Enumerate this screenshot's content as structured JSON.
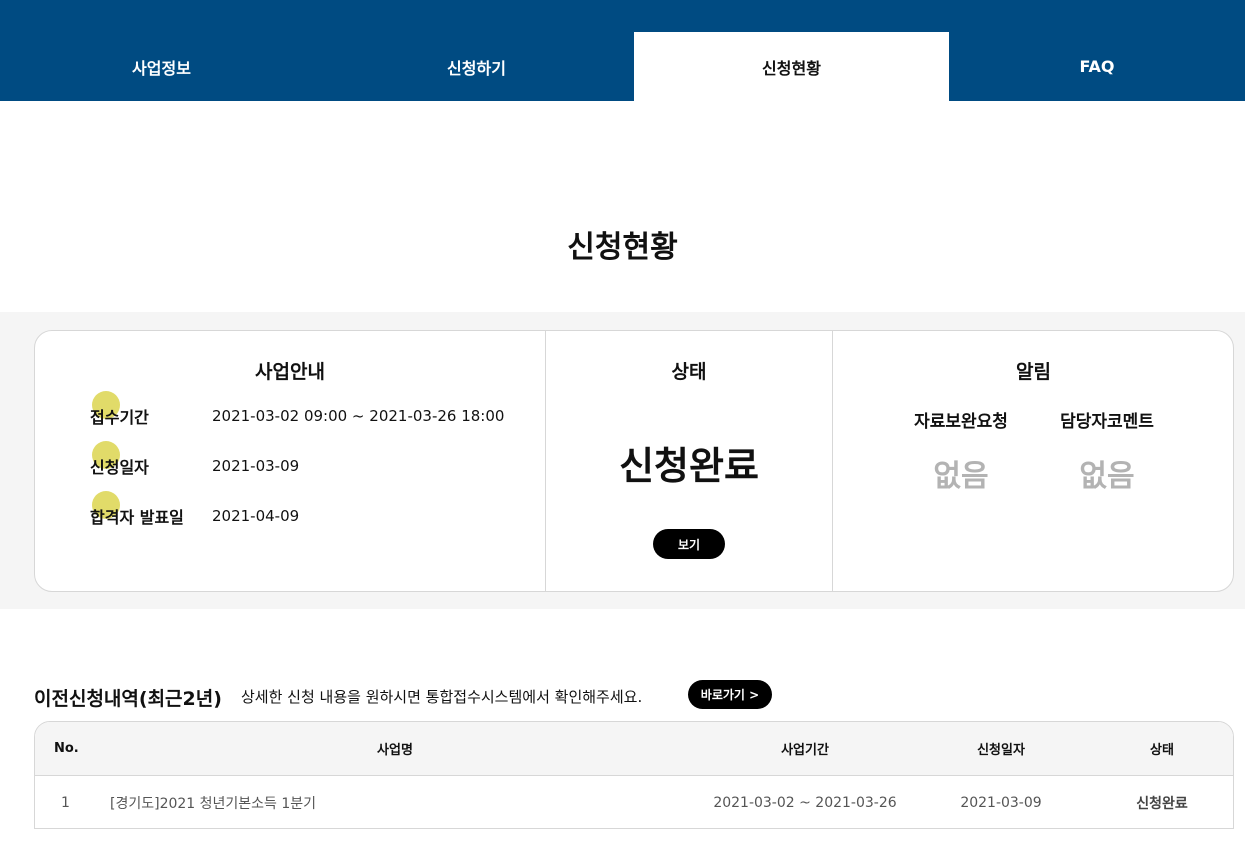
{
  "nav": {
    "tabs": [
      {
        "label": "사업정보"
      },
      {
        "label": "신청하기"
      },
      {
        "label": "신청현황"
      },
      {
        "label": "FAQ"
      }
    ],
    "active_tab": "신청현황"
  },
  "page_title": "신청현황",
  "business_info": {
    "heading": "사업안내",
    "rows": [
      {
        "label": "접수기간",
        "value": "2021-03-02 09:00 ~ 2021-03-26 18:00"
      },
      {
        "label": "신청일자",
        "value": "2021-03-09"
      },
      {
        "label": "합격자 발표일",
        "value": "2021-04-09"
      }
    ]
  },
  "status": {
    "heading": "상태",
    "value": "신청완료",
    "view_button": "보기"
  },
  "notice": {
    "heading": "알림",
    "items": [
      {
        "label": "자료보완요청",
        "value": "없음"
      },
      {
        "label": "담당자코멘트",
        "value": "없음"
      }
    ]
  },
  "history": {
    "title": "이전신청내역(최근2년)",
    "description": "상세한 신청 내용을 원하시면 통합접수시스템에서 확인해주세요.",
    "go_button": "바로가기 >",
    "columns": [
      "No.",
      "사업명",
      "사업기간",
      "신청일자",
      "상태"
    ],
    "rows": [
      {
        "no": "1",
        "name": "[경기도]2021 청년기본소득 1분기",
        "period": "2021-03-02 ~ 2021-03-26",
        "date": "2021-03-09",
        "status": "신청완료"
      }
    ]
  },
  "colors": {
    "nav_bg": "#004b82",
    "highlight_dot": "#dcd54f",
    "muted_value": "#b3b3b3"
  }
}
